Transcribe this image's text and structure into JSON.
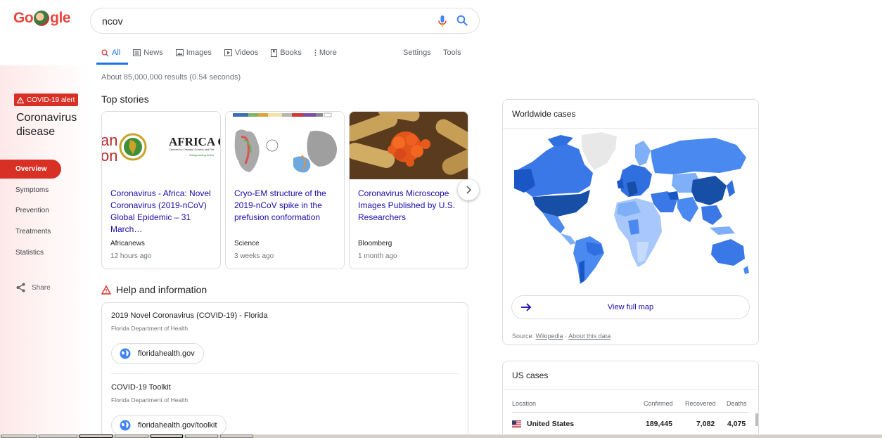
{
  "logo": {
    "text_left": "Go",
    "text_right": "gle"
  },
  "search": {
    "query": "ncov"
  },
  "tabs": [
    {
      "label": "All"
    },
    {
      "label": "News"
    },
    {
      "label": "Images"
    },
    {
      "label": "Videos"
    },
    {
      "label": "Books"
    },
    {
      "label": "More"
    }
  ],
  "toolbar": {
    "settings": "Settings",
    "tools": "Tools"
  },
  "results_count": "About 85,000,000 results (0.54 seconds)",
  "sidebar": {
    "alert": "COVID-19 alert",
    "title": "Coronavirus disease",
    "items": [
      {
        "label": "Overview"
      },
      {
        "label": "Symptoms"
      },
      {
        "label": "Prevention"
      },
      {
        "label": "Treatments"
      },
      {
        "label": "Statistics"
      }
    ],
    "share": "Share"
  },
  "top_stories": {
    "title": "Top stories",
    "cards": [
      {
        "title": "Coronavirus - Africa: Novel Coronavirus (2019-nCoV) Global Epidemic – 31 March…",
        "source": "Africanews",
        "time": "12 hours ago",
        "thumb_text_a": "an",
        "thumb_text_b": "on",
        "thumb_brand": "AFRICA CD",
        "thumb_sub1": "Centres for Disease Control and Pre",
        "thumb_sub2": "Safeguarding Africa"
      },
      {
        "title": "Cryo-EM structure of the 2019-nCoV spike in the prefusion conformation",
        "source": "Science",
        "time": "3 weeks ago"
      },
      {
        "title": "Coronavirus Microscope Images Published by U.S. Researchers",
        "source": "Bloomberg",
        "time": "1 month ago"
      }
    ]
  },
  "help": {
    "title": "Help and information",
    "items": [
      {
        "title": "2019 Novel Coronavirus (COVID-19) - Florida",
        "org": "Florida Department of Health",
        "link": "floridahealth.gov"
      },
      {
        "title": "COVID-19 Toolkit",
        "org": "Florida Department of Health",
        "link": "floridahealth.gov/toolkit"
      }
    ]
  },
  "worldwide": {
    "title": "Worldwide cases",
    "full_map": "View full map",
    "source_label": "Source:",
    "source_link": "Wikipedia",
    "separator": "·",
    "about": "About this data"
  },
  "us_cases": {
    "title": "US cases",
    "headers": {
      "location": "Location",
      "confirmed": "Confirmed",
      "recovered": "Recovered",
      "deaths": "Deaths"
    },
    "rows": [
      {
        "location": "United States",
        "confirmed": "189,445",
        "recovered": "7,082",
        "deaths": "4,075"
      }
    ]
  },
  "colors": {
    "accent_red": "#d93025",
    "link_blue": "#1a0dab",
    "tab_blue": "#1a73e8",
    "map_dark": "#174ea6",
    "map_light": "#a8c7fa"
  }
}
